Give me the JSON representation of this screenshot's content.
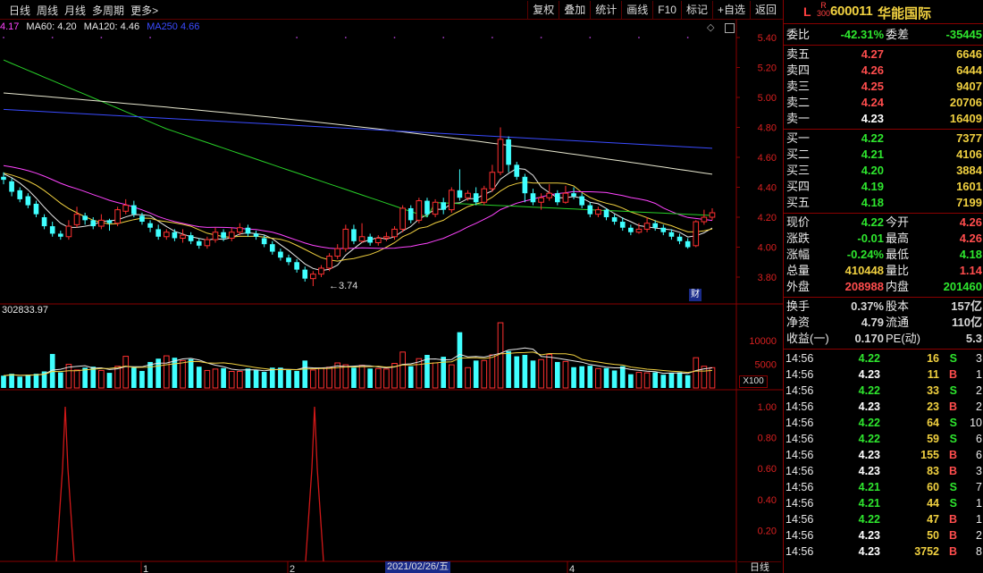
{
  "toolbar": {
    "left_items": [
      "日线",
      "周线",
      "月线",
      "多周期",
      "更多>"
    ],
    "right_buttons": [
      "复权",
      "叠加",
      "统计",
      "画线",
      "F10",
      "标记",
      "+自选",
      "返回"
    ]
  },
  "ma_legend": [
    {
      "text": "4.17",
      "color": "#ff44ff"
    },
    {
      "text": "MA60: 4.20",
      "color": "#e8e8e8"
    },
    {
      "text": "MA120: 4.46",
      "color": "#e8e8e8"
    },
    {
      "text": "MA250  4.66",
      "color": "#3a4bff"
    }
  ],
  "volume_legend": "302833.97",
  "volume_unit": "X100",
  "finance_badge": "财",
  "low_label": "3.74",
  "date_box": "2021/02/26/五",
  "axis_tab": "日线",
  "price_axis": [
    "5.40",
    "5.20",
    "5.00",
    "4.80",
    "4.60",
    "4.40",
    "4.20",
    "4.00",
    "3.80"
  ],
  "volume_axis": [
    "10000",
    "5000"
  ],
  "indicator_axis": [
    "1.00",
    "0.80",
    "0.60",
    "0.40",
    "0.20"
  ],
  "month_marks": [
    "1",
    "2",
    "4"
  ],
  "chart_data": {
    "type": "candlestick",
    "ylim": [
      3.7,
      5.45
    ],
    "candles": [
      [
        4.47,
        4.45,
        4.5,
        4.42
      ],
      [
        4.44,
        4.37,
        4.46,
        4.34
      ],
      [
        4.38,
        4.32,
        4.4,
        4.3
      ],
      [
        4.34,
        4.28,
        4.36,
        4.26
      ],
      [
        4.29,
        4.22,
        4.31,
        4.2
      ],
      [
        4.2,
        4.14,
        4.22,
        4.12
      ],
      [
        4.14,
        4.09,
        4.17,
        4.07
      ],
      [
        4.09,
        4.07,
        4.11,
        4.05
      ],
      [
        4.07,
        4.14,
        4.18,
        4.05
      ],
      [
        4.15,
        4.22,
        4.27,
        4.13
      ],
      [
        4.21,
        4.18,
        4.23,
        4.15
      ],
      [
        4.18,
        4.14,
        4.2,
        4.12
      ],
      [
        4.14,
        4.18,
        4.22,
        4.12
      ],
      [
        4.18,
        4.16,
        4.19,
        4.11
      ],
      [
        4.16,
        4.25,
        4.27,
        4.14
      ],
      [
        4.24,
        4.28,
        4.32,
        4.22
      ],
      [
        4.28,
        4.22,
        4.31,
        4.2
      ],
      [
        4.21,
        4.17,
        4.23,
        4.15
      ],
      [
        4.16,
        4.13,
        4.18,
        4.1
      ],
      [
        4.12,
        4.07,
        4.15,
        4.05
      ],
      [
        4.07,
        4.1,
        4.12,
        4.05
      ],
      [
        4.1,
        4.06,
        4.12,
        4.04
      ],
      [
        4.06,
        4.08,
        4.12,
        4.03
      ],
      [
        4.08,
        4.04,
        4.1,
        4.02
      ],
      [
        4.04,
        4.01,
        4.06,
        3.99
      ],
      [
        4.01,
        4.05,
        4.07,
        3.99
      ],
      [
        4.05,
        4.1,
        4.13,
        4.03
      ],
      [
        4.1,
        4.06,
        4.12,
        4.04
      ],
      [
        4.06,
        4.1,
        4.13,
        4.04
      ],
      [
        4.1,
        4.13,
        4.16,
        4.08
      ],
      [
        4.13,
        4.09,
        4.15,
        4.07
      ],
      [
        4.09,
        4.07,
        4.11,
        4.05
      ],
      [
        4.06,
        4.02,
        4.08,
        4.0
      ],
      [
        4.02,
        3.97,
        4.04,
        3.95
      ],
      [
        3.97,
        3.93,
        3.99,
        3.91
      ],
      [
        3.93,
        3.9,
        3.95,
        3.88
      ],
      [
        3.9,
        3.85,
        3.92,
        3.83
      ],
      [
        3.85,
        3.79,
        3.87,
        3.77
      ],
      [
        3.79,
        3.82,
        3.84,
        3.74
      ],
      [
        3.82,
        3.86,
        3.88,
        3.8
      ],
      [
        3.86,
        3.94,
        3.96,
        3.84
      ],
      [
        3.94,
        3.99,
        4.02,
        3.92
      ],
      [
        3.99,
        4.12,
        4.15,
        3.97
      ],
      [
        4.12,
        4.04,
        4.15,
        4.02
      ],
      [
        4.04,
        4.07,
        4.16,
        4.03
      ],
      [
        4.07,
        4.03,
        4.09,
        4.01
      ],
      [
        4.03,
        4.06,
        4.08,
        4.01
      ],
      [
        4.06,
        4.07,
        4.1,
        4.04
      ],
      [
        4.07,
        4.12,
        4.14,
        4.05
      ],
      [
        4.12,
        4.26,
        4.28,
        4.1
      ],
      [
        4.26,
        4.18,
        4.28,
        4.16
      ],
      [
        4.18,
        4.31,
        4.33,
        4.16
      ],
      [
        4.31,
        4.22,
        4.33,
        4.2
      ],
      [
        4.22,
        4.3,
        4.32,
        4.2
      ],
      [
        4.3,
        4.25,
        4.33,
        4.22
      ],
      [
        4.25,
        4.38,
        4.4,
        4.23
      ],
      [
        4.38,
        4.33,
        4.52,
        4.31
      ],
      [
        4.33,
        4.36,
        4.38,
        4.31
      ],
      [
        4.36,
        4.3,
        4.4,
        4.28
      ],
      [
        4.3,
        4.39,
        4.41,
        4.28
      ],
      [
        4.39,
        4.5,
        4.55,
        4.37
      ],
      [
        4.5,
        4.72,
        4.8,
        4.48
      ],
      [
        4.72,
        4.55,
        4.74,
        4.5
      ],
      [
        4.55,
        4.47,
        4.57,
        4.45
      ],
      [
        4.47,
        4.36,
        4.49,
        4.3
      ],
      [
        4.36,
        4.3,
        4.39,
        4.28
      ],
      [
        4.3,
        4.33,
        4.36,
        4.25
      ],
      [
        4.33,
        4.36,
        4.42,
        4.31
      ],
      [
        4.36,
        4.3,
        4.38,
        4.28
      ],
      [
        4.3,
        4.36,
        4.41,
        4.29
      ],
      [
        4.36,
        4.34,
        4.4,
        4.32
      ],
      [
        4.34,
        4.28,
        4.36,
        4.26
      ],
      [
        4.28,
        4.22,
        4.3,
        4.2
      ],
      [
        4.22,
        4.25,
        4.27,
        4.2
      ],
      [
        4.25,
        4.2,
        4.26,
        4.18
      ],
      [
        4.2,
        4.17,
        4.22,
        4.15
      ],
      [
        4.17,
        4.13,
        4.2,
        4.11
      ],
      [
        4.13,
        4.1,
        4.15,
        4.08
      ],
      [
        4.1,
        4.12,
        4.16,
        4.09
      ],
      [
        4.12,
        4.16,
        4.2,
        4.1
      ],
      [
        4.16,
        4.13,
        4.18,
        4.11
      ],
      [
        4.13,
        4.1,
        4.15,
        4.08
      ],
      [
        4.1,
        4.07,
        4.12,
        4.05
      ],
      [
        4.07,
        4.04,
        4.09,
        4.02
      ],
      [
        4.04,
        4.0,
        4.06,
        3.99
      ],
      [
        4.01,
        4.17,
        4.18,
        4.0
      ],
      [
        4.17,
        4.2,
        4.25,
        4.15
      ],
      [
        4.2,
        4.23,
        4.26,
        4.18
      ]
    ],
    "volumes": [
      2600,
      3000,
      2400,
      2800,
      3000,
      3500,
      7200,
      3300,
      5000,
      3800,
      4300,
      4500,
      3700,
      3200,
      4600,
      6700,
      4300,
      3600,
      5500,
      6200,
      6800,
      6400,
      5800,
      6100,
      4500,
      3700,
      4000,
      4200,
      3500,
      3500,
      4100,
      3800,
      3400,
      4300,
      4300,
      3800,
      3600,
      5800,
      3800,
      4200,
      4400,
      5300,
      4900,
      4300,
      4800,
      4100,
      4100,
      4000,
      5200,
      7600,
      4600,
      6200,
      7000,
      5300,
      6600,
      4900,
      11800,
      4300,
      5800,
      5800,
      7000,
      13800,
      7800,
      6700,
      7000,
      5800,
      6000,
      7100,
      5500,
      5600,
      4400,
      4600,
      4700,
      4100,
      4200,
      3700,
      4600,
      2900,
      3300,
      3200,
      3300,
      2800,
      3200,
      3300,
      2700,
      6400,
      4600,
      4300
    ],
    "indicator_peaks": [
      73,
      352
    ]
  },
  "quote": {
    "L": "L",
    "R_top": "R",
    "R_bottom": "300",
    "code": "600011",
    "name": "华能国际",
    "weibi_label": "委比",
    "weibi": "-42.31%",
    "weicha_label": "委差",
    "weicha": "-35445",
    "asks": [
      {
        "label": "卖五",
        "price": "4.27",
        "vol": "6646"
      },
      {
        "label": "卖四",
        "price": "4.26",
        "vol": "6444"
      },
      {
        "label": "卖三",
        "price": "4.25",
        "vol": "9407"
      },
      {
        "label": "卖二",
        "price": "4.24",
        "vol": "20706"
      },
      {
        "label": "卖一",
        "price": "4.23",
        "vol": "16409"
      }
    ],
    "bids": [
      {
        "label": "买一",
        "price": "4.22",
        "vol": "7377"
      },
      {
        "label": "买二",
        "price": "4.21",
        "vol": "4106"
      },
      {
        "label": "买三",
        "price": "4.20",
        "vol": "3884"
      },
      {
        "label": "买四",
        "price": "4.19",
        "vol": "1601"
      },
      {
        "label": "买五",
        "price": "4.18",
        "vol": "7199"
      }
    ],
    "stats": [
      {
        "l1": "现价",
        "v1": "4.22",
        "c1": "green",
        "l2": "今开",
        "v2": "4.26",
        "c2": "red"
      },
      {
        "l1": "涨跌",
        "v1": "-0.01",
        "c1": "green",
        "l2": "最高",
        "v2": "4.26",
        "c2": "red"
      },
      {
        "l1": "涨幅",
        "v1": "-0.24%",
        "c1": "green",
        "l2": "最低",
        "v2": "4.18",
        "c2": "green"
      },
      {
        "l1": "总量",
        "v1": "410448",
        "c1": "yellow",
        "l2": "量比",
        "v2": "1.14",
        "c2": "red"
      },
      {
        "l1": "外盘",
        "v1": "208988",
        "c1": "red",
        "l2": "内盘",
        "v2": "201460",
        "c2": "green"
      }
    ],
    "stats2": [
      {
        "l1": "换手",
        "v1": "0.37%",
        "l2": "股本",
        "v2": "157亿"
      },
      {
        "l1": "净资",
        "v1": "4.79",
        "l2": "流通",
        "v2": "110亿"
      },
      {
        "l1": "收益(一)",
        "v1": "0.170",
        "l2": "PE(动)",
        "v2": "5.3"
      }
    ]
  },
  "ticks": [
    {
      "time": "14:56",
      "price": "4.22",
      "pc": "green",
      "vol": "16",
      "dir": "S",
      "n": "3"
    },
    {
      "time": "14:56",
      "price": "4.23",
      "pc": "white",
      "vol": "11",
      "dir": "B",
      "n": "1"
    },
    {
      "time": "14:56",
      "price": "4.22",
      "pc": "green",
      "vol": "33",
      "dir": "S",
      "n": "2"
    },
    {
      "time": "14:56",
      "price": "4.23",
      "pc": "white",
      "vol": "23",
      "dir": "B",
      "n": "2"
    },
    {
      "time": "14:56",
      "price": "4.22",
      "pc": "green",
      "vol": "64",
      "dir": "S",
      "n": "10"
    },
    {
      "time": "14:56",
      "price": "4.22",
      "pc": "green",
      "vol": "59",
      "dir": "S",
      "n": "6"
    },
    {
      "time": "14:56",
      "price": "4.23",
      "pc": "white",
      "vol": "155",
      "dir": "B",
      "n": "6"
    },
    {
      "time": "14:56",
      "price": "4.23",
      "pc": "white",
      "vol": "83",
      "dir": "B",
      "n": "3"
    },
    {
      "time": "14:56",
      "price": "4.21",
      "pc": "green",
      "vol": "60",
      "dir": "S",
      "n": "7"
    },
    {
      "time": "14:56",
      "price": "4.21",
      "pc": "green",
      "vol": "44",
      "dir": "S",
      "n": "1"
    },
    {
      "time": "14:56",
      "price": "4.22",
      "pc": "green",
      "vol": "47",
      "dir": "B",
      "n": "1"
    },
    {
      "time": "14:56",
      "price": "4.23",
      "pc": "white",
      "vol": "50",
      "dir": "B",
      "n": "2"
    },
    {
      "time": "14:56",
      "price": "4.23",
      "pc": "white",
      "vol": "3752",
      "dir": "B",
      "n": "8"
    }
  ]
}
